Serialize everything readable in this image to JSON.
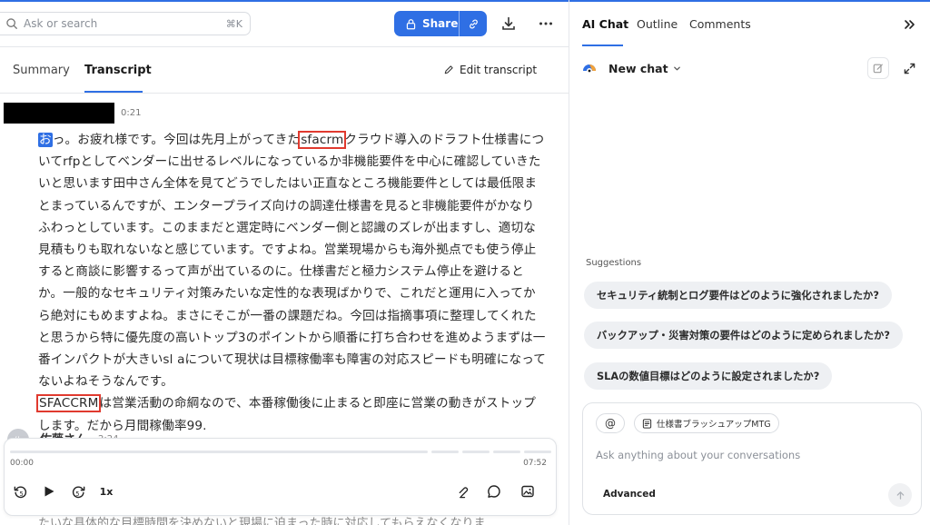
{
  "header": {
    "search_placeholder": "Ask or search",
    "search_shortcut": "⌘K",
    "share_label": "Share"
  },
  "tabs": {
    "summary": "Summary",
    "transcript": "Transcript",
    "edit_transcript": "Edit transcript"
  },
  "transcript": {
    "speaker1_time": "0:21",
    "seg_first": "お",
    "seg_a": "っ。お疲れ様です。今回は先月上がってきた",
    "term1": "sfacrm",
    "seg_b": "クラウド導入のドラフト仕様書についてrfpとしてベンダーに出せるレベルになっているか非機能要件を中心に確認していきたいと思います田中さん全体を見てどうでしたはい正直なところ機能要件としては最低限まとまっているんですが、エンタープライズ向けの調達仕様書を見ると非機能要件がかなりふわっとしています。このままだと選定時にベンダー側と認識のズレが出ますし、適切な見積もりも取れないなと感じています。ですよね。営業現場からも海外拠点でも使う停止すると商談に影響するって声が出ているのに。仕様書だと極力システム停止を避けるとか。一般的なセキュリティ対策みたいな定性的な表現ばかりで、これだと運用に入ってから絶対にもめますよね。まさにそこが一番の課題だね。今回は指摘事項に整理してくれたと思うから特に優先度の高いトップ3のポイントから順番に打ち合わせを進めようまずは一番インパクトが大きいsl aについて現状は目標稼働率も障害の対応スピードも明確になってないよねそうなんです。",
    "term2": "SFACCRM",
    "seg_c": "は営業活動の命綱なので、本番稼働後に止まると即座に営業の動きがストップします。だから月間稼働率99.",
    "speaker2_initial": "佐",
    "speaker2_name": "佐藤さん",
    "speaker2_time": "2:24",
    "bottom_text": "たいな具体的な目標時間を決めないと現場に迫まった時に対応してもらえなくなりま"
  },
  "player": {
    "progress": 0,
    "current_time": "00:00",
    "total_time": "07:52",
    "speed": "1x"
  },
  "right_panel": {
    "tabs": [
      "AI Chat",
      "Outline",
      "Comments"
    ],
    "new_chat": "New chat",
    "suggestions_title": "Suggestions",
    "suggestions": [
      "セキュリティ統制とログ要件はどのように強化されましたか?",
      "バックアップ・災害対策の要件はどのように定められましたか?",
      "SLAの数値目標はどのように設定されましたか?"
    ],
    "composer": {
      "at_label": "@",
      "context_chip": "仕様書ブラッシュアップMTG",
      "placeholder": "Ask anything about your conversations",
      "advanced": "Advanced"
    }
  },
  "colors": {
    "accent": "#2f6fe4",
    "highlight_box": "#e03a2f"
  }
}
